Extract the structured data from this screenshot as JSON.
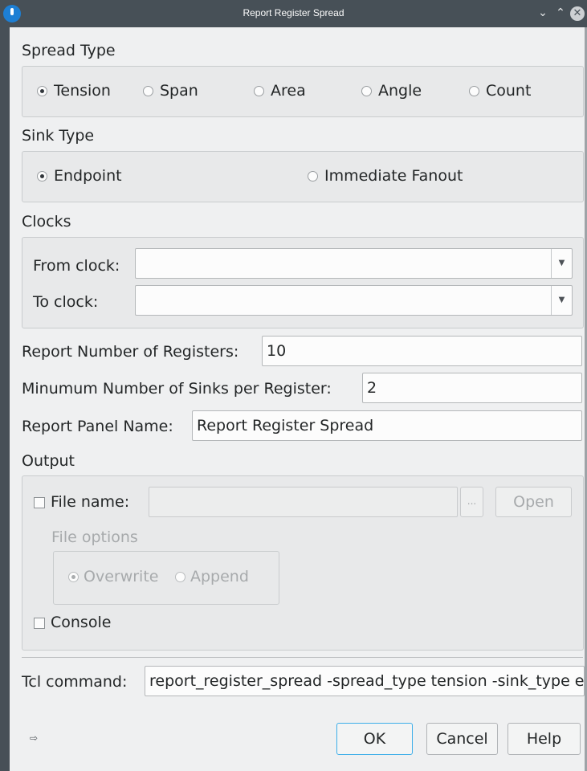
{
  "window": {
    "title": "Report Register Spread",
    "icons": [
      "app-icon",
      "minimize-icon",
      "maximize-icon",
      "close-icon"
    ]
  },
  "spread_type": {
    "heading": "Spread Type",
    "options": [
      "Tension",
      "Span",
      "Area",
      "Angle",
      "Count"
    ],
    "selected": "Tension"
  },
  "sink_type": {
    "heading": "Sink Type",
    "options": [
      "Endpoint",
      "Immediate Fanout"
    ],
    "selected": "Endpoint"
  },
  "clocks": {
    "heading": "Clocks",
    "from_label": "From clock:",
    "from_value": "",
    "to_label": "To clock:",
    "to_value": ""
  },
  "report_number": {
    "label": "Report Number of Registers:",
    "value": "10"
  },
  "min_sinks": {
    "label": "Minumum Number of Sinks per Register:",
    "value": "2"
  },
  "panel_name": {
    "label": "Report Panel Name:",
    "value": "Report Register Spread"
  },
  "output": {
    "heading": "Output",
    "file_name_label": "File name:",
    "file_name_checked": false,
    "file_name_value": "",
    "browse_label": "...",
    "open_label": "Open",
    "file_options_label": "File options",
    "overwrite_label": "Overwrite",
    "append_label": "Append",
    "file_option_selected": "Overwrite",
    "console_label": "Console",
    "console_checked": false
  },
  "tcl": {
    "label": "Tcl command:",
    "value": "report_register_spread -spread_type tension -sink_type endpoint"
  },
  "buttons": {
    "ok": "OK",
    "cancel": "Cancel",
    "help": "Help"
  }
}
